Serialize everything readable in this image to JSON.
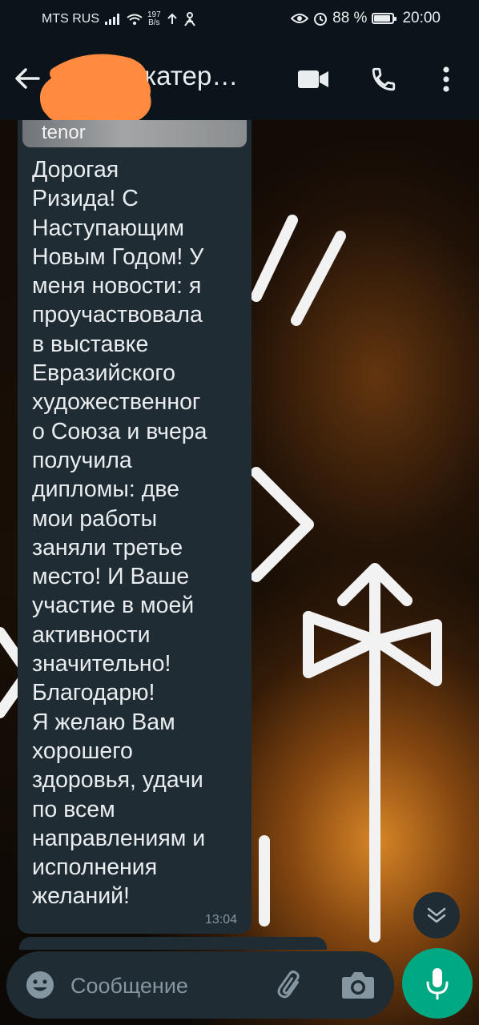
{
  "status_bar": {
    "carrier": "MTS RUS",
    "speed_value": "197",
    "speed_unit": "B/s",
    "battery": "88 %",
    "battery_level": 0.88,
    "time": "20:00"
  },
  "header": {
    "chat_name": "Екатер…",
    "icons": [
      "back-arrow-icon",
      "video-call-icon",
      "voice-call-icon",
      "more-options-icon"
    ]
  },
  "message": {
    "gif_label": "tenor",
    "text": "Дорогая\nРизида! С\nНаступающим\nНовым Годом! У\nменя новости: я\nпроучаствовала\nв выставке\nЕвразийского\nхудожественног\nо Союза и вчера\nполучила\nдипломы: две\nмои работы\nзаняли третье\nместо! И Ваше\nучастие в моей\nактивности\nзначительно!\nБлагодарю!\nЯ желаю Вам\nхорошего\nздоровья, удачи\nпо всем\nнаправлениям и\nисполнения\nжеланий!",
    "time": "13:04"
  },
  "composer": {
    "placeholder": "Сообщение",
    "icons": [
      "emoji-icon",
      "attach-icon",
      "camera-icon",
      "mic-icon"
    ]
  },
  "colors": {
    "header_bg": "#0b141a",
    "bubble_bg": "#1f2c34",
    "accent_green": "#00a884",
    "muted_text": "#8696a0"
  }
}
